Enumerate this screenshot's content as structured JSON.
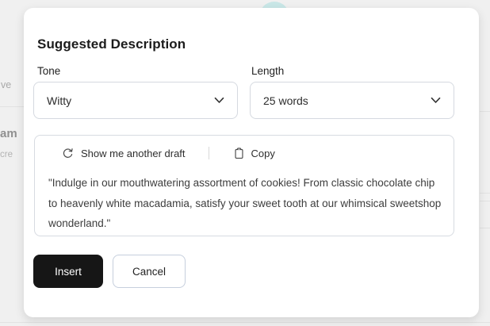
{
  "dialog": {
    "title": "Suggested Description",
    "tone": {
      "label": "Tone",
      "value": "Witty"
    },
    "length": {
      "label": "Length",
      "value": "25 words"
    },
    "draft": {
      "regenerate_label": "Show me another draft",
      "copy_label": "Copy",
      "text": "\"Indulge in our mouthwatering assortment of cookies! From classic chocolate chip to heavenly white macadamia, satisfy your sweet tooth at our whimsical sweetshop wonderland.\""
    },
    "insert_label": "Insert",
    "cancel_label": "Cancel"
  },
  "background": {
    "fragment_top": "ve",
    "fragment_mid": "am",
    "fragment_bottom": "cre"
  },
  "icons": {
    "regenerate": "refresh-icon",
    "copy": "clipboard-icon",
    "selects": "chevron-down-icon"
  },
  "colors": {
    "backdrop": "#f0f0f0",
    "modal": "#ffffff",
    "field_border": "#d5d9e0",
    "primary_button": "#161616",
    "cancel_border": "#c6cfdd",
    "title_text": "#1c1c1c",
    "body_text": "#3d3d3d",
    "accent_teal": "#c9e7e7"
  }
}
